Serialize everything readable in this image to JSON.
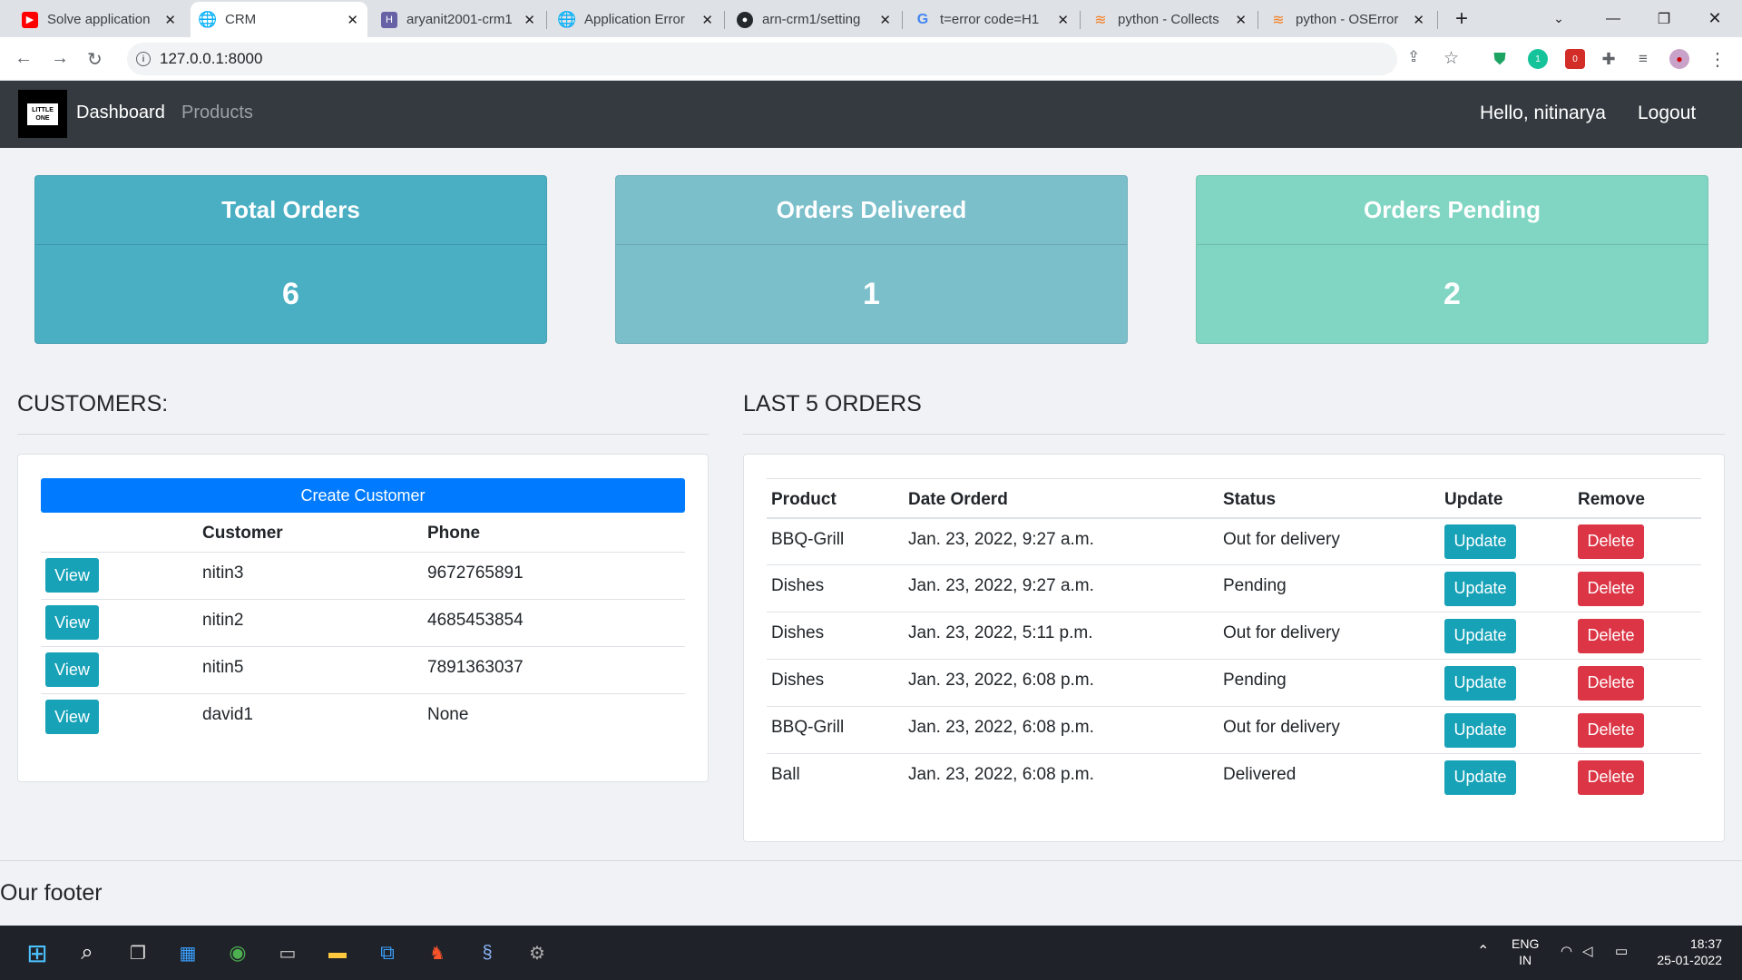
{
  "browser": {
    "tabs": [
      {
        "title": "Solve application",
        "favicon": "youtube-icon",
        "active": false
      },
      {
        "title": "CRM",
        "favicon": "globe-icon",
        "active": true
      },
      {
        "title": "aryanit2001-crm1",
        "favicon": "heroku-icon",
        "active": false
      },
      {
        "title": "Application Error",
        "favicon": "globe-icon",
        "active": false
      },
      {
        "title": "arn-crm1/setting",
        "favicon": "github-icon",
        "active": false
      },
      {
        "title": "t=error code=H1",
        "favicon": "google-icon",
        "active": false
      },
      {
        "title": "python - Collects",
        "favicon": "stackoverflow-icon",
        "active": false
      },
      {
        "title": "python - OSError",
        "favicon": "stackoverflow-icon",
        "active": false
      }
    ],
    "url": "127.0.0.1:8000",
    "ext_badges": {
      "grammarly": "1",
      "lastpass": "0"
    }
  },
  "navbar": {
    "brand_logo_text_1": "LITTLE",
    "brand_logo_text_2": "ONE",
    "links": [
      "Dashboard",
      "Products"
    ],
    "greeting": "Hello, nitinarya",
    "logout": "Logout"
  },
  "stats": [
    {
      "title": "Total Orders",
      "value": "6",
      "color": "#4aafc3"
    },
    {
      "title": "Orders Delivered",
      "value": "1",
      "color": "#7bbfcb"
    },
    {
      "title": "Orders Pending",
      "value": "2",
      "color": "#80d6c3"
    }
  ],
  "customers": {
    "heading": "CUSTOMERS:",
    "create_label": "Create Customer",
    "columns": [
      "",
      "Customer",
      "Phone"
    ],
    "view_label": "View",
    "rows": [
      {
        "name": "nitin3",
        "phone": "9672765891"
      },
      {
        "name": "nitin2",
        "phone": "4685453854"
      },
      {
        "name": "nitin5",
        "phone": "7891363037"
      },
      {
        "name": "david1",
        "phone": "None"
      }
    ]
  },
  "orders": {
    "heading": "LAST 5 ORDERS",
    "columns": [
      "Product",
      "Date Orderd",
      "Status",
      "Update",
      "Remove"
    ],
    "update_label": "Update",
    "delete_label": "Delete",
    "rows": [
      {
        "product": "BBQ-Grill",
        "date": "Jan. 23, 2022, 9:27 a.m.",
        "status": "Out for delivery"
      },
      {
        "product": "Dishes",
        "date": "Jan. 23, 2022, 9:27 a.m.",
        "status": "Pending"
      },
      {
        "product": "Dishes",
        "date": "Jan. 23, 2022, 5:11 p.m.",
        "status": "Out for delivery"
      },
      {
        "product": "Dishes",
        "date": "Jan. 23, 2022, 6:08 p.m.",
        "status": "Pending"
      },
      {
        "product": "BBQ-Grill",
        "date": "Jan. 23, 2022, 6:08 p.m.",
        "status": "Out for delivery"
      },
      {
        "product": "Ball",
        "date": "Jan. 23, 2022, 6:08 p.m.",
        "status": "Delivered"
      }
    ]
  },
  "footer": {
    "text": "Our footer"
  },
  "taskbar": {
    "lang_1": "ENG",
    "lang_2": "IN",
    "time": "18:37",
    "date": "25-01-2022"
  }
}
